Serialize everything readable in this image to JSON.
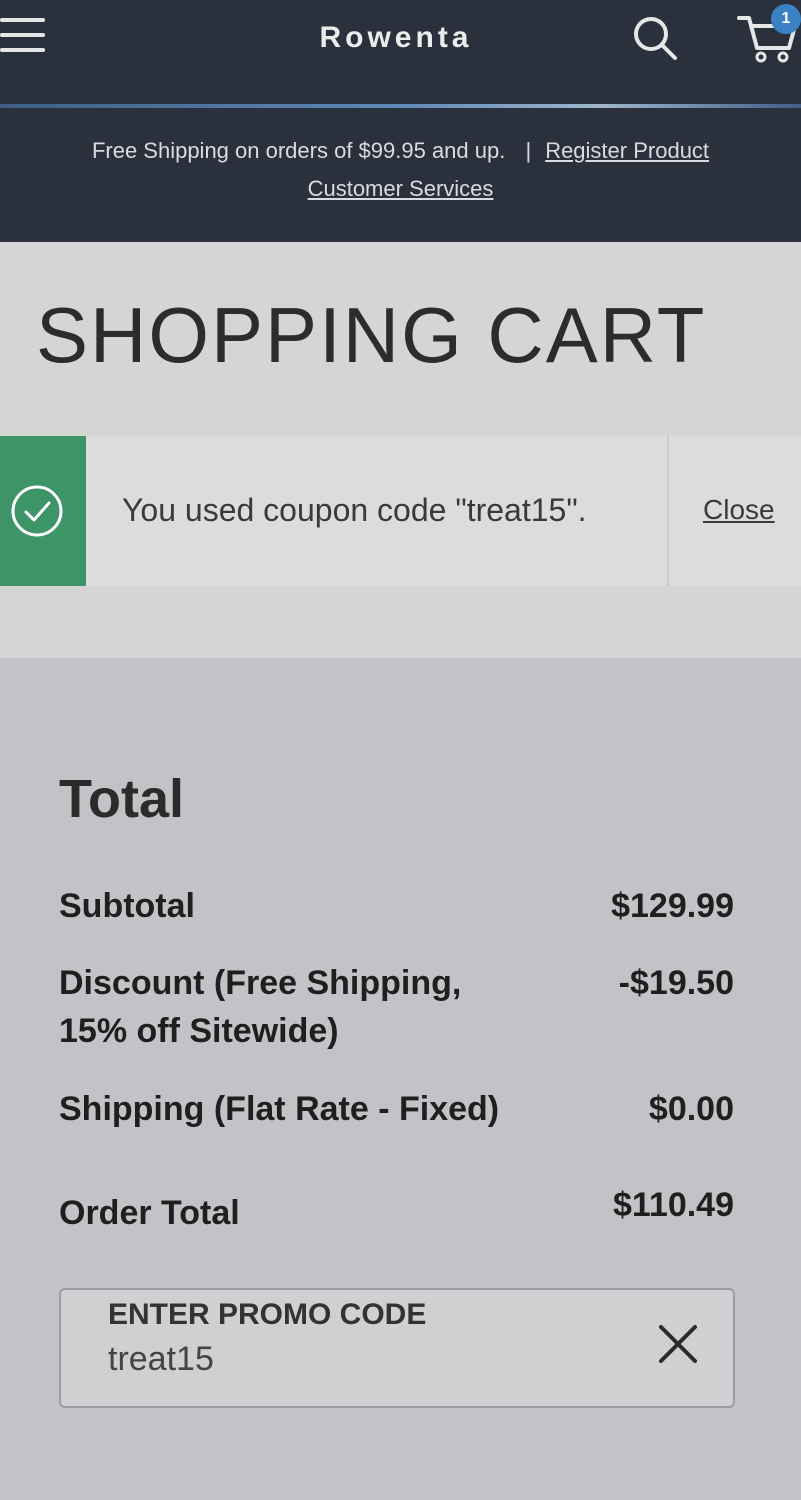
{
  "header": {
    "logo_text": "Rowenta",
    "cart_count": "1",
    "colors": {
      "background": "#2b313c",
      "badge": "#3b82c4"
    }
  },
  "promo_bar": {
    "text": "Free Shipping on orders of $99.95 and up.",
    "separator": "|",
    "links": [
      "Register Product",
      "Customer Services"
    ]
  },
  "page": {
    "title": "SHOPPING CART"
  },
  "notice": {
    "icon": "check-circle-icon",
    "message": "You used coupon code \"treat15\".",
    "close_label": "Close",
    "color": "#3d9466"
  },
  "summary": {
    "title": "Total",
    "rows": [
      {
        "label": "Subtotal",
        "value": "$129.99"
      },
      {
        "label": "Discount (Free Shipping,",
        "label_line2": "15% off Sitewide)",
        "value": "-$19.50"
      },
      {
        "label": "Shipping (Flat Rate - Fixed)",
        "value": "$0.00"
      },
      {
        "label": "Order Total",
        "value": "$110.49"
      }
    ]
  },
  "promo_code": {
    "label": "ENTER PROMO CODE",
    "value": "treat15",
    "clear_icon": "close-icon"
  }
}
